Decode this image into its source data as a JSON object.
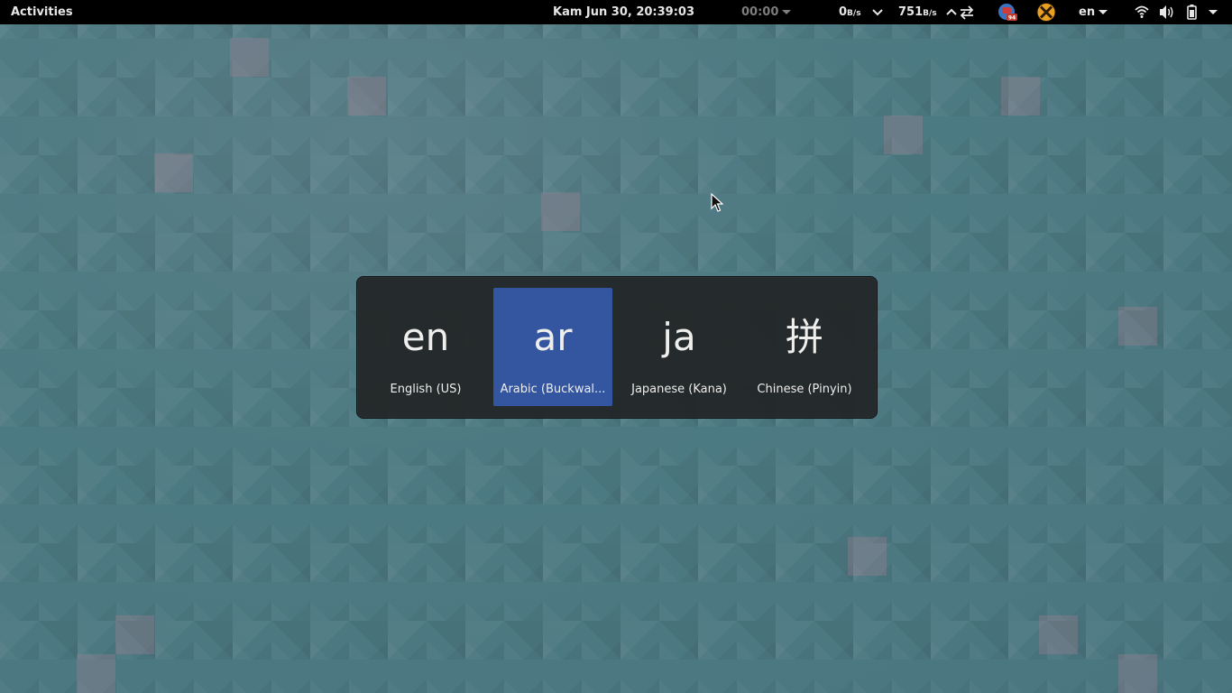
{
  "topbar": {
    "activities": "Activities",
    "clock": "Kam Jun 30, 20:39:03",
    "timer": "00:00",
    "netspeed": {
      "down_value": "0",
      "down_unit": "B/s",
      "up_value": "751",
      "up_unit": "B/s"
    },
    "keyboard_layout": "en",
    "badge_count": "94"
  },
  "input_switcher": {
    "selected_index": 1,
    "sources": [
      {
        "glyph": "en",
        "label": "English (US)"
      },
      {
        "glyph": "ar",
        "label": "Arabic (Buckwal..."
      },
      {
        "glyph": "ja",
        "label": "Japanese (Kana)"
      },
      {
        "glyph": "拼",
        "label": "Chinese (Pinyin)"
      }
    ]
  },
  "colors": {
    "topbar_bg": "#000000",
    "topbar_text": "#e6e6e6",
    "switcher_bg": "#232627",
    "selection": "#3455a0",
    "desktop": "#4f7b84"
  }
}
